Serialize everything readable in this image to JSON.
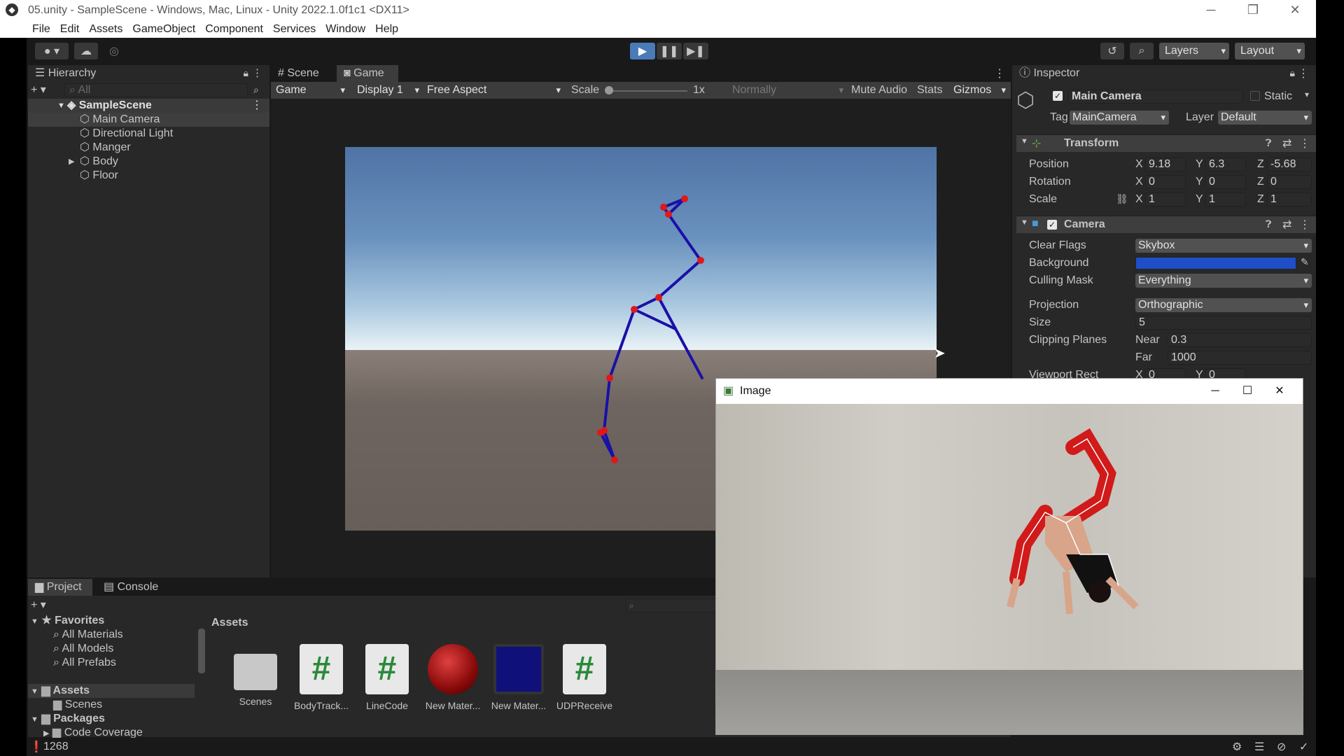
{
  "window": {
    "title": "05.unity - SampleScene - Windows, Mac, Linux - Unity 2022.1.0f1c1 <DX11>",
    "minimize": "─",
    "maximize": "❐",
    "close": "✕"
  },
  "menu": [
    "File",
    "Edit",
    "Assets",
    "GameObject",
    "Component",
    "Services",
    "Window",
    "Help"
  ],
  "toolbar": {
    "layers_label": "Layers",
    "layout_label": "Layout"
  },
  "hierarchy": {
    "tab_label": "Hierarchy",
    "search_placeholder": "All",
    "scene_name": "SampleScene",
    "items": [
      "Main Camera",
      "Directional Light",
      "Manger",
      "Body",
      "Floor"
    ]
  },
  "game_view": {
    "tabs": [
      "Scene",
      "Game"
    ],
    "mode": "Game",
    "display": "Display 1",
    "aspect": "Free Aspect",
    "scale_label": "Scale",
    "scale_value": "1x",
    "vsync": "Normally",
    "mute_audio": "Mute Audio",
    "stats": "Stats",
    "gizmos": "Gizmos",
    "skeleton_color": "#1a10a8",
    "joint_color": "#e01818"
  },
  "inspector": {
    "tab_label": "Inspector",
    "object_name": "Main Camera",
    "static_label": "Static",
    "tag_label": "Tag",
    "tag_value": "MainCamera",
    "layer_label": "Layer",
    "layer_value": "Default",
    "transform": {
      "title": "Transform",
      "position_label": "Position",
      "rotation_label": "Rotation",
      "scale_label": "Scale",
      "position": {
        "x": "9.18",
        "y": "6.3",
        "z": "-5.68"
      },
      "rotation": {
        "x": "0",
        "y": "0",
        "z": "0"
      },
      "scale": {
        "x": "1",
        "y": "1",
        "z": "1"
      }
    },
    "camera": {
      "title": "Camera",
      "clear_flags_label": "Clear Flags",
      "clear_flags": "Skybox",
      "background_label": "Background",
      "background_color": "#1f4fc8",
      "culling_mask_label": "Culling Mask",
      "culling_mask": "Everything",
      "projection_label": "Projection",
      "projection": "Orthographic",
      "size_label": "Size",
      "size": "5",
      "clipping_label": "Clipping Planes",
      "near_label": "Near",
      "near": "0.3",
      "far_label": "Far",
      "far": "1000",
      "viewport_label": "Viewport Rect",
      "viewport_x": "0",
      "viewport_y": "0"
    },
    "axis": {
      "x": "X",
      "y": "Y",
      "z": "Z"
    }
  },
  "project": {
    "tabs": [
      "Project",
      "Console"
    ],
    "favorites_label": "Favorites",
    "favorites": [
      "All Materials",
      "All Models",
      "All Prefabs"
    ],
    "assets_label": "Assets",
    "assets_children": [
      "Scenes"
    ],
    "packages_label": "Packages",
    "packages_children": [
      "Code Coverage"
    ],
    "breadcrumb": "Assets",
    "files": [
      {
        "name": "Scenes",
        "kind": "folder"
      },
      {
        "name": "BodyTrack...",
        "kind": "script"
      },
      {
        "name": "LineCode",
        "kind": "script"
      },
      {
        "name": "New Mater...",
        "kind": "material-red"
      },
      {
        "name": "New Mater...",
        "kind": "material-blue"
      },
      {
        "name": "UDPReceive",
        "kind": "script"
      }
    ]
  },
  "image_window": {
    "title": "Image"
  },
  "status": {
    "count": "1268"
  }
}
